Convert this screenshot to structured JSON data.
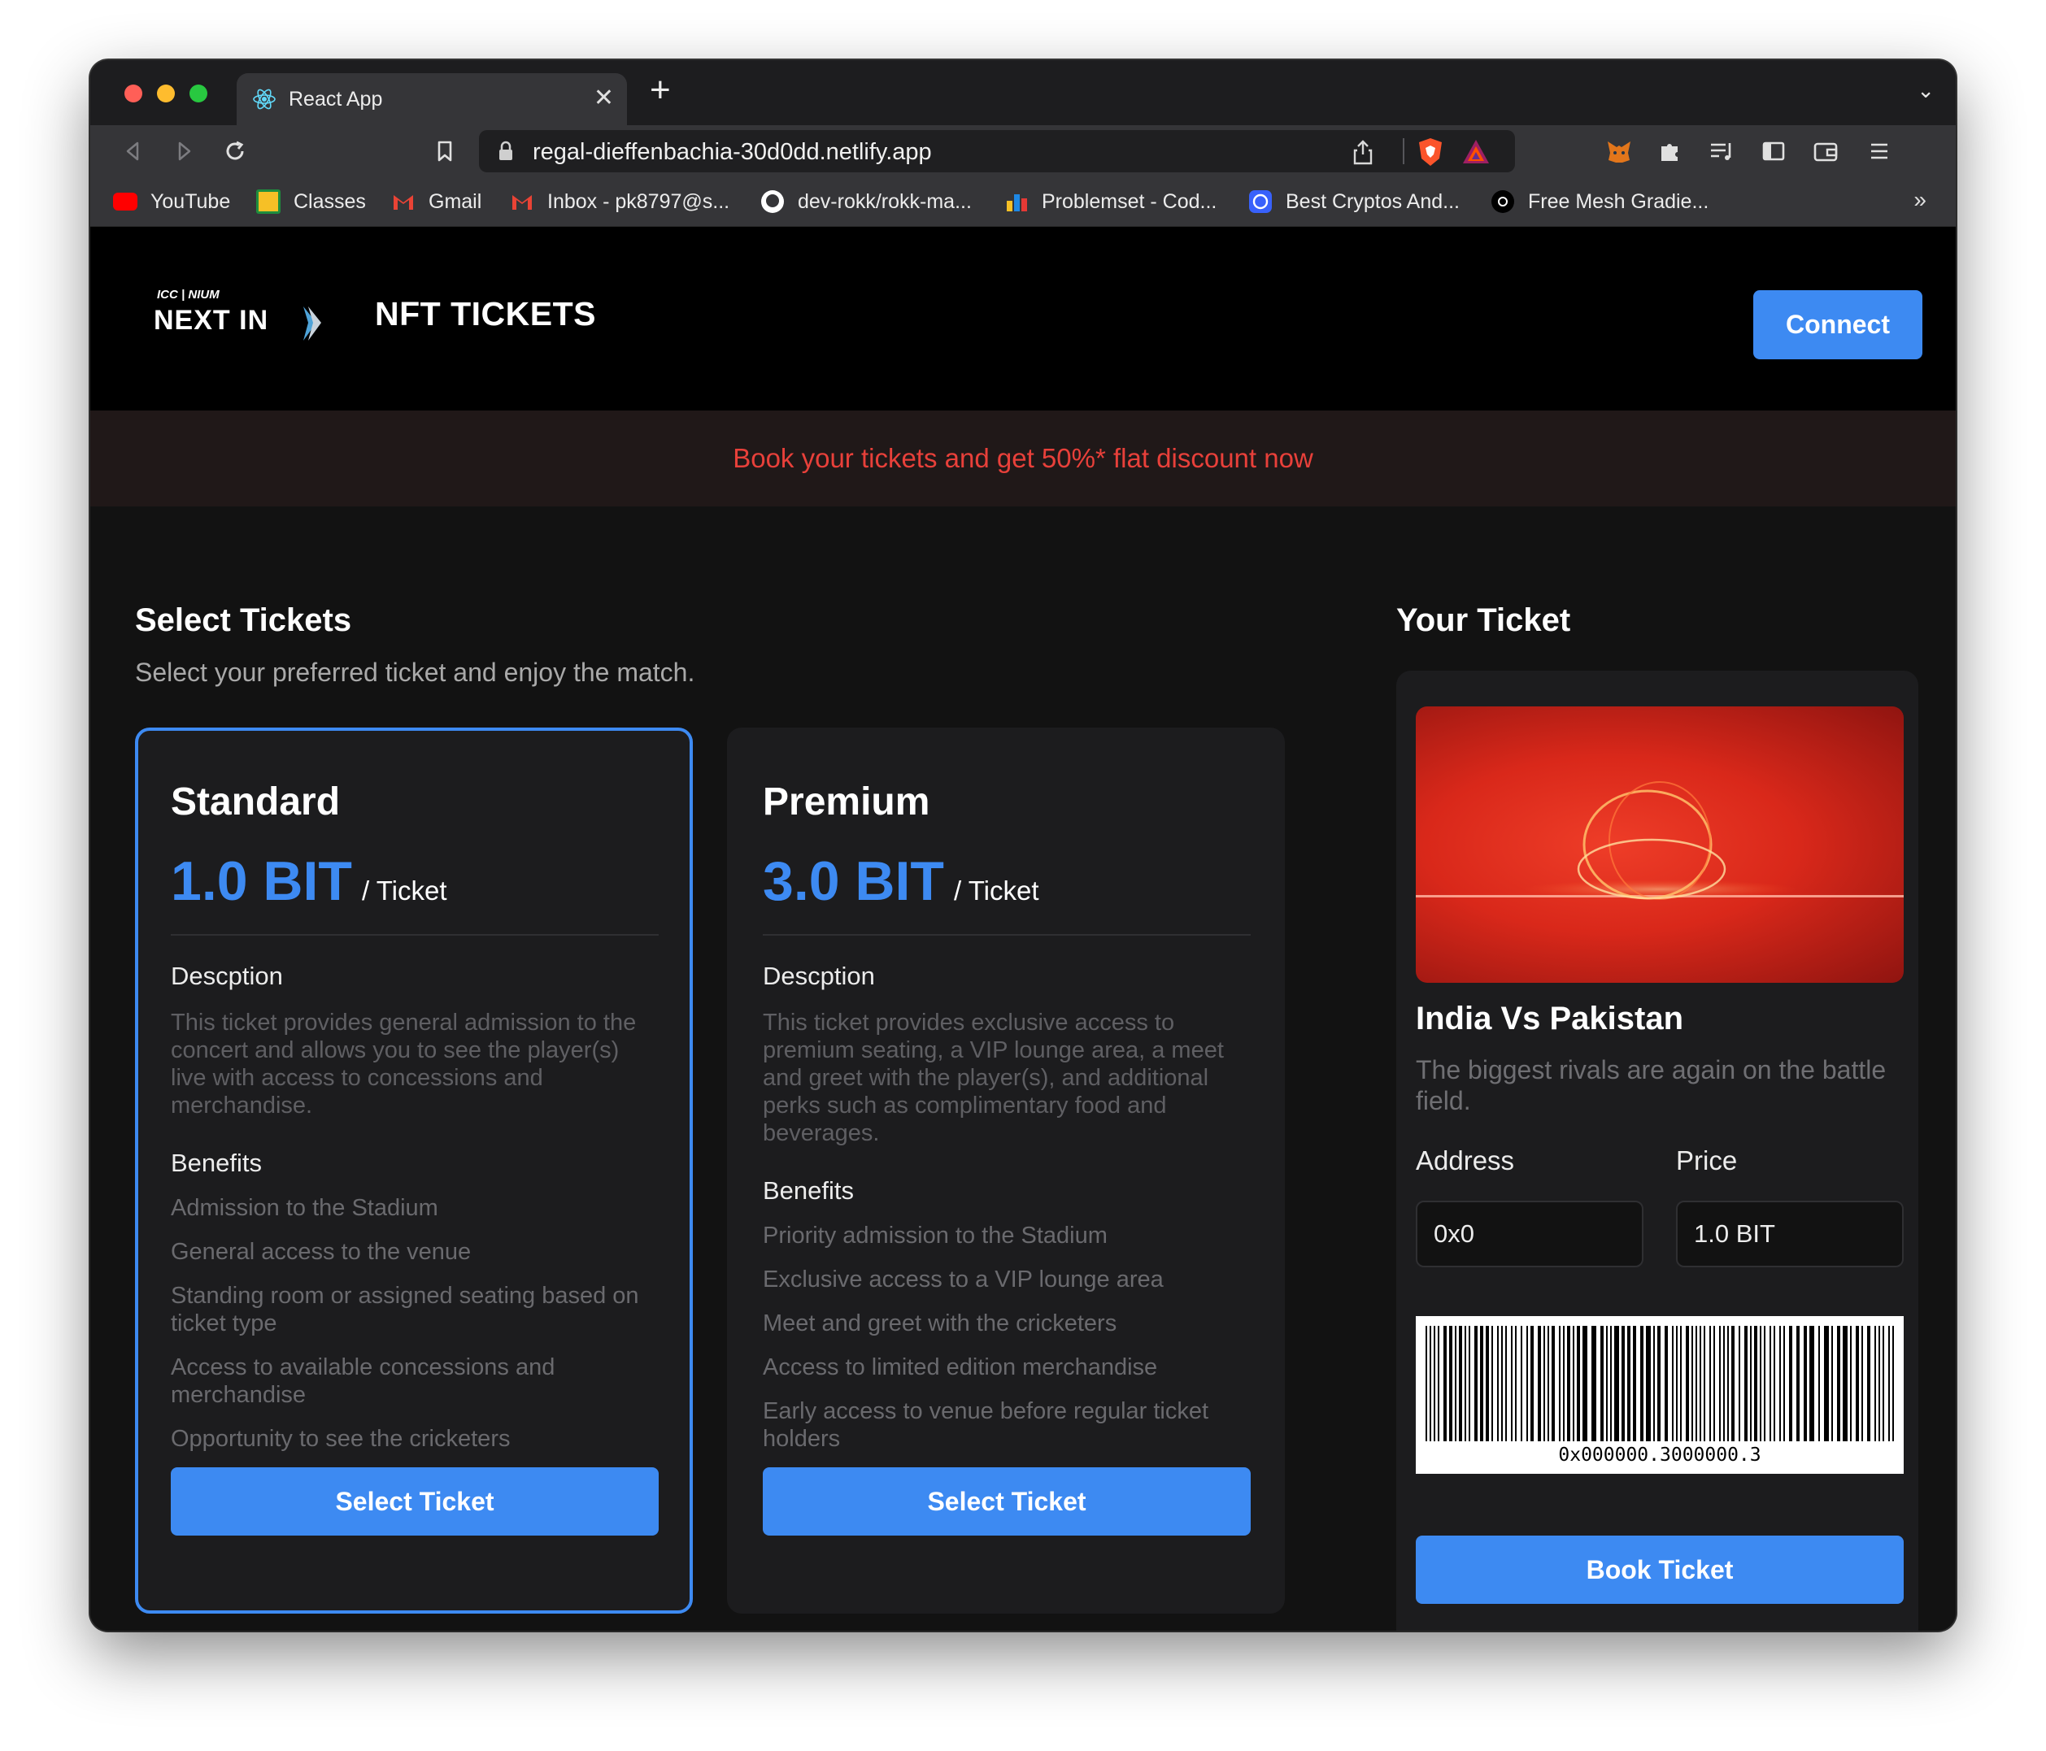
{
  "browser": {
    "tab_title": "React App",
    "url": "regal-dieffenbachia-30d0dd.netlify.app",
    "bookmarks": [
      {
        "label": "YouTube",
        "icon": "youtube-icon"
      },
      {
        "label": "Classes",
        "icon": "classroom-icon"
      },
      {
        "label": "Gmail",
        "icon": "gmail-icon"
      },
      {
        "label": "Inbox - pk8797@s...",
        "icon": "gmail-icon"
      },
      {
        "label": "dev-rokk/rokk-ma...",
        "icon": "github-icon"
      },
      {
        "label": "Problemset - Cod...",
        "icon": "codeforces-icon"
      },
      {
        "label": "Best Cryptos And...",
        "icon": "coinmarketcap-icon"
      },
      {
        "label": "Free Mesh Gradie...",
        "icon": "mesh-icon"
      }
    ],
    "bookmarks_more": "»"
  },
  "header": {
    "logo_top": "ICC | NIUM",
    "logo_main": "NEXT IN",
    "title": "NFT TICKETS",
    "connect_label": "Connect"
  },
  "promo": {
    "text": "Book your tickets and get 50%* flat discount now",
    "color": "#e8403a"
  },
  "select": {
    "title": "Select Tickets",
    "subtitle": "Select your preferred ticket and enjoy the match."
  },
  "cards": [
    {
      "name": "Standard",
      "price": "1.0 BIT",
      "unit": "/ Ticket",
      "desc_heading": "Descption",
      "description": "This ticket provides general admission to the concert and allows you to see the player(s) live with access to concessions and merchandise.",
      "benefits_heading": "Benefits",
      "benefits": [
        "Admission to the Stadium",
        "General access to the venue",
        "Standing room or assigned seating based on ticket type",
        "Access to available concessions and merchandise",
        "Opportunity to see the cricketers"
      ],
      "button": "Select Ticket"
    },
    {
      "name": "Premium",
      "price": "3.0 BIT",
      "unit": "/ Ticket",
      "desc_heading": "Descption",
      "description": "This ticket provides exclusive access to premium seating, a VIP lounge area, a meet and greet with the player(s), and additional perks such as complimentary food and beverages.",
      "benefits_heading": "Benefits",
      "benefits": [
        "Priority admission to the Stadium",
        "Exclusive access to a VIP lounge area",
        "Meet and greet with the cricketers",
        "Access to limited edition merchandise",
        "Early access to venue before regular ticket holders"
      ],
      "button": "Select Ticket"
    }
  ],
  "ticket": {
    "section_title": "Your Ticket",
    "title": "India Vs Pakistan",
    "description": "The biggest rivals are again on the battle field.",
    "address_label": "Address",
    "address_value": "0x0",
    "price_label": "Price",
    "price_value": "1.0 BIT",
    "barcode_text": "0x000000.3000000.3",
    "book_label": "Book Ticket"
  },
  "colors": {
    "accent": "#3d8af2",
    "background": "#121212",
    "card": "#1c1c1e"
  }
}
